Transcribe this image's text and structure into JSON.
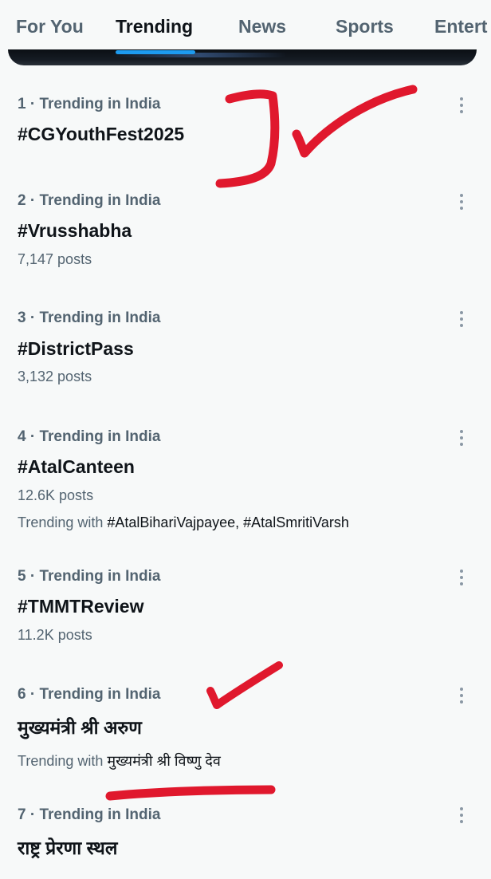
{
  "tabs": [
    {
      "label": "For You"
    },
    {
      "label": "Trending"
    },
    {
      "label": "News"
    },
    {
      "label": "Sports"
    },
    {
      "label": "Entert"
    }
  ],
  "active_tab": "Trending",
  "trends": [
    {
      "context": "1 · Trending in India",
      "name": "#CGYouthFest2025"
    },
    {
      "context": "2 · Trending in India",
      "name": "#Vrusshabha",
      "posts": "7,147 posts"
    },
    {
      "context": "3 · Trending in India",
      "name": "#DistrictPass",
      "posts": "3,132 posts"
    },
    {
      "context": "4 · Trending in India",
      "name": "#AtalCanteen",
      "posts": "12.6K posts",
      "with_prefix": "Trending with ",
      "with_tags": "#AtalBihariVajpayee, #AtalSmritiVarsh"
    },
    {
      "context": "5 · Trending in India",
      "name": "#TMMTReview",
      "posts": "11.2K posts"
    },
    {
      "context": "6 · Trending in India",
      "name": "मुख्यमंत्री श्री अरुण",
      "with_prefix": "Trending with ",
      "with_tags": "मुख्यमंत्री श्री विष्णु देव"
    },
    {
      "context": "7 · Trending in India",
      "name": "राष्ट्र प्रेरणा स्थल"
    }
  ],
  "colors": {
    "accent": "#1d9bf0",
    "annotation": "#e0182d",
    "secondary_text": "#536471"
  },
  "icons": {
    "more": "more-vertical-icon"
  }
}
